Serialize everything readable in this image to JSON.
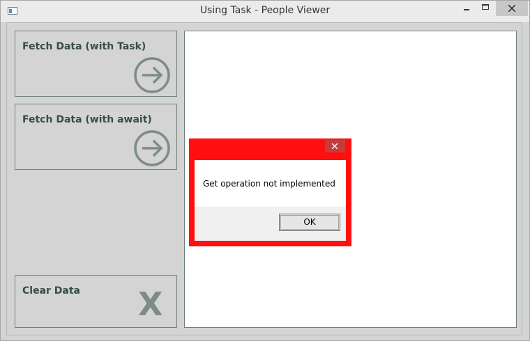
{
  "window": {
    "title": "Using Task - People Viewer"
  },
  "buttons": {
    "fetch_task": "Fetch Data (with Task)",
    "fetch_await": "Fetch Data (with await)",
    "clear": "Clear Data",
    "clear_icon_glyph": "X"
  },
  "dialog": {
    "message": "Get operation not implemented",
    "ok_label": "OK"
  },
  "colors": {
    "dialog_frame": "#ff0f0f",
    "button_text": "#374c48",
    "icon_gray": "#7e8c89"
  }
}
